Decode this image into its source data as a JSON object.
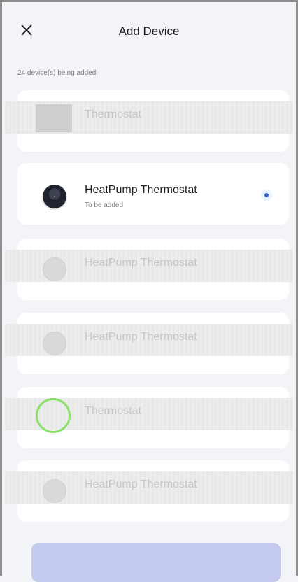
{
  "header": {
    "title": "Add Device"
  },
  "status_text": "24 device(s) being added",
  "devices": [
    {
      "name": "Thermostat",
      "sub": "",
      "state": "faded"
    },
    {
      "name": "HeatPump Thermostat",
      "sub": "To be added",
      "state": "active"
    },
    {
      "name": "HeatPump Thermostat",
      "sub": "",
      "state": "faded"
    },
    {
      "name": "HeatPump Thermostat",
      "sub": "",
      "state": "faded"
    },
    {
      "name": "Thermostat",
      "sub": "",
      "state": "loading"
    },
    {
      "name": "HeatPump Thermostat",
      "sub": "",
      "state": "faded"
    }
  ],
  "icons": {
    "close": "close-icon",
    "device": "thermostat-icon",
    "selected": "radio-selected-icon"
  },
  "colors": {
    "background": "#f3f4f7",
    "card": "#ffffff",
    "accent": "#3b63c4",
    "loading_ring": "#8be06a",
    "bottom_button": "#c3c9ef"
  }
}
